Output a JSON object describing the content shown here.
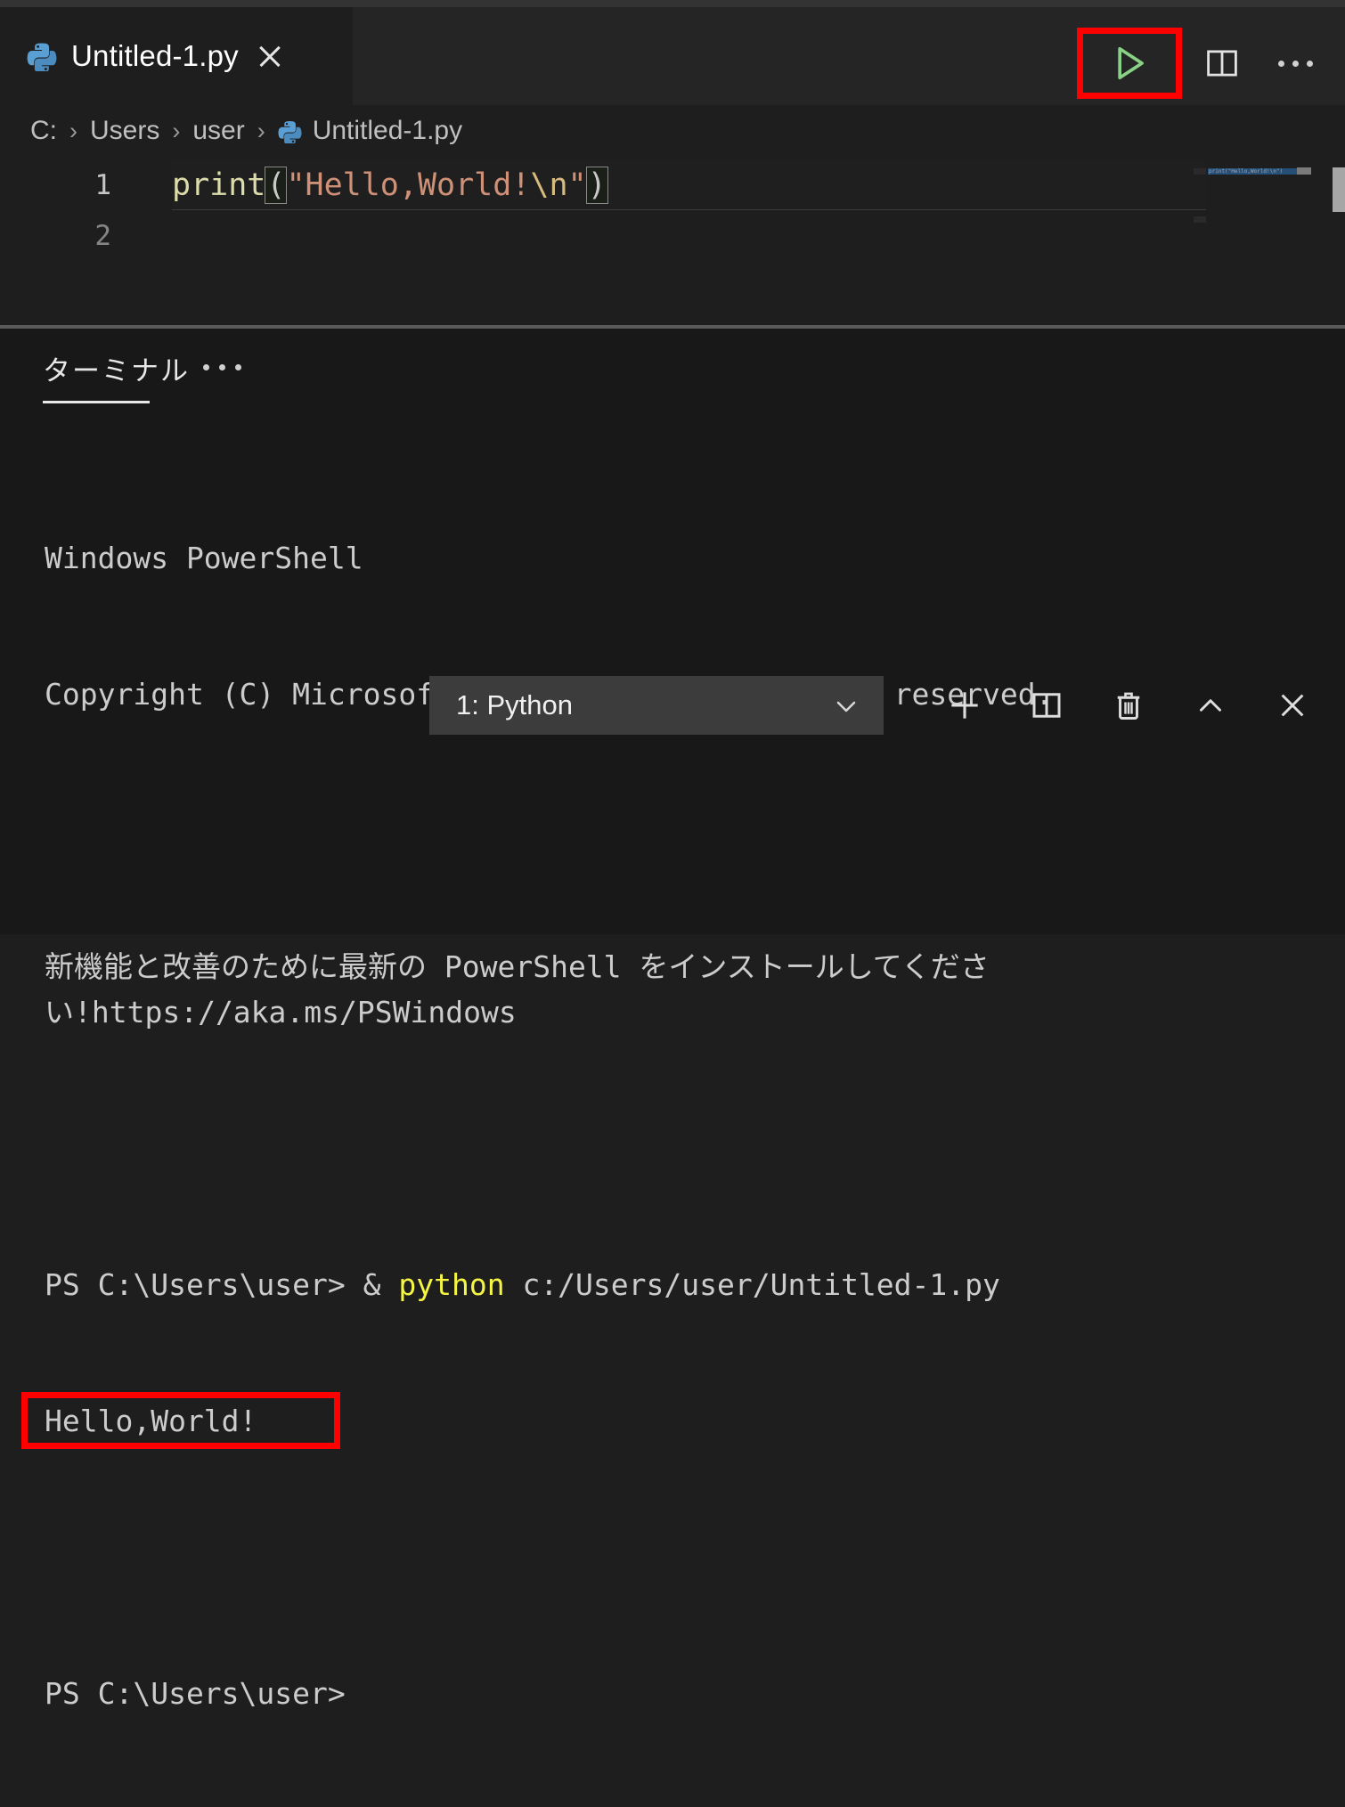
{
  "window": {
    "background": "#1e1e1e",
    "accent_highlight": "#ff0000"
  },
  "editor": {
    "tab": {
      "title": "Untitled-1.py",
      "icon": "python-icon",
      "close_icon": "close-icon"
    },
    "actions": {
      "run_label": "run-python-file",
      "run_icon": "play-triangle-icon",
      "split_icon": "split-editor-icon",
      "more_icon": "more-actions-ellipsis-icon"
    },
    "breadcrumb": {
      "separator": "›",
      "items": [
        "C:",
        "Users",
        "user",
        "Untitled-1.py"
      ],
      "file_icon": "python-icon"
    },
    "lines": [
      {
        "number": "1",
        "active": true
      },
      {
        "number": "2",
        "active": false
      }
    ],
    "code": {
      "fn": "print",
      "open_paren": "(",
      "string_start": "\"Hello,World!",
      "escape": "\\n",
      "string_end": "\"",
      "close_paren": ")",
      "full_text": "print(\"Hello,World!\\n\")"
    },
    "minimap": {
      "code_preview": "print(\"Hello,World!\\n\")"
    }
  },
  "panel": {
    "tab_label": "ターミナル",
    "more_icon": "more-actions-ellipsis-icon",
    "terminal_select": {
      "value": "1: Python",
      "chevron_icon": "chevron-down-icon"
    },
    "actions": {
      "new_terminal_icon": "plus-icon",
      "split_terminal_icon": "split-terminal-icon",
      "kill_terminal_icon": "trash-icon",
      "maximize_icon": "chevron-up-icon",
      "close_icon": "close-icon"
    }
  },
  "terminal": {
    "lines": [
      "Windows PowerShell",
      "Copyright (C) Microsoft Corporation. All rights reserved."
    ],
    "notice": "新機能と改善のために最新の PowerShell をインストールしてください!https://aka.ms/PSWindows",
    "prompt": "PS C:\\Users\\user> & ",
    "command_highlight": "python",
    "command_args": " c:/Users/user/Untitled-1.py",
    "output": "Hello,World!",
    "final_prompt": "PS C:\\Users\\user>"
  }
}
